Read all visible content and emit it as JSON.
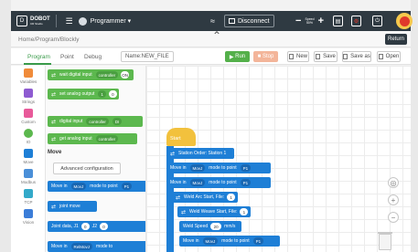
{
  "colors": {
    "topbar": "#2f3a42",
    "accent_green": "#5cb84e",
    "block_blue": "#1e7fd6",
    "start_yellow": "#f2c13d",
    "stop_orange": "#f3b59a",
    "estop_red": "#e0382b"
  },
  "topbar": {
    "logo_mark": "D",
    "logo_name": "DOBOT",
    "logo_sub": "CR Studio",
    "menu_icon": "menu-icon",
    "user_icon": "user-icon",
    "user_label": "Programmer ▾",
    "wifi_icon": "wifi-icon",
    "disconnect_label": "Disconnect",
    "speed_minus": "−",
    "speed_label_top": "Speed",
    "speed_label_bottom": "50%",
    "speed_plus": "+",
    "doc_icon": "document-icon",
    "settings_icon": "settings-icon",
    "estop_icon": "emergency-stop-icon"
  },
  "breadcrumb": {
    "text": "Home/Program/Blockly",
    "collapse_icon": "chevron-up-icon",
    "return_label": "Return"
  },
  "toolbar": {
    "tabs": [
      "Program",
      "Point",
      "Debug"
    ],
    "file_name": "Name:NEW_FILE",
    "run_label": "Run",
    "stop_label": "Stop",
    "new_label": "New",
    "save_label": "Save",
    "save_as_label": "Save as",
    "open_label": "Open"
  },
  "categories": [
    {
      "label": "Variables",
      "color": "#f08b3a"
    },
    {
      "label": "Strings",
      "color": "#8e5bd1"
    },
    {
      "label": "Custom",
      "color": "#e85a9a"
    },
    {
      "label": "IO",
      "color": "#5cb84e"
    },
    {
      "label": "Move",
      "color": "#1e7fd6"
    },
    {
      "label": "Modbus",
      "color": "#4a8fd8"
    },
    {
      "label": "TCP",
      "color": "#33a9c9"
    },
    {
      "label": "Vision",
      "color": "#3b7dd8"
    }
  ],
  "flyout": {
    "io_blocks": [
      {
        "label": "wait digital input",
        "pill": "controller",
        "extra": "ON"
      },
      {
        "label": "set analog output",
        "pill": "1",
        "extra": "0"
      },
      {
        "label": "digital input",
        "pill": "controller",
        "extra": "DI"
      },
      {
        "label": "get analog input",
        "pill": "controller",
        "extra": ""
      }
    ],
    "section_title": "Move",
    "adv_config_label": "Advanced configuration",
    "move_blocks": [
      {
        "label": "Move in",
        "pill": "MovJ",
        "tail": "mode to point",
        "pill2": "P1"
      },
      {
        "label": "joint move",
        "pill": "",
        "tail": "",
        "pill2": ""
      },
      {
        "label": "Joint data, J1",
        "pill": "0",
        "tail": "J2",
        "pill2": "0"
      },
      {
        "label": "Move in",
        "pill": "RelMovJ",
        "tail": "mode to",
        "pill2": ""
      }
    ]
  },
  "workspace": {
    "start_label": "Start",
    "blocks": [
      {
        "label": "Station Order: Station 1",
        "pill": "",
        "tail": "",
        "pill2": ""
      },
      {
        "label": "Move in",
        "pill": "MovJ",
        "tail": "mode to point",
        "pill2": "P1"
      },
      {
        "label": "Move in",
        "pill": "MovJ",
        "tail": "mode to point",
        "pill2": "P1"
      },
      {
        "label": "Weld Arc Start, File:",
        "pill": "1",
        "tail": "",
        "pill2": ""
      },
      {
        "label": "Weld Weave Start, File:",
        "pill": "1",
        "tail": "",
        "pill2": ""
      },
      {
        "label": "Weld Speed",
        "pill": "20",
        "tail": "mm/s",
        "pill2": ""
      },
      {
        "label": "Move in",
        "pill": "MovJ",
        "tail": "mode to point",
        "pill2": "P1"
      }
    ],
    "zoom_in_icon": "zoom-in-icon",
    "zoom_out_icon": "zoom-out-icon",
    "zoom_reset_icon": "zoom-reset-icon",
    "trash_icon": "trash-icon"
  }
}
